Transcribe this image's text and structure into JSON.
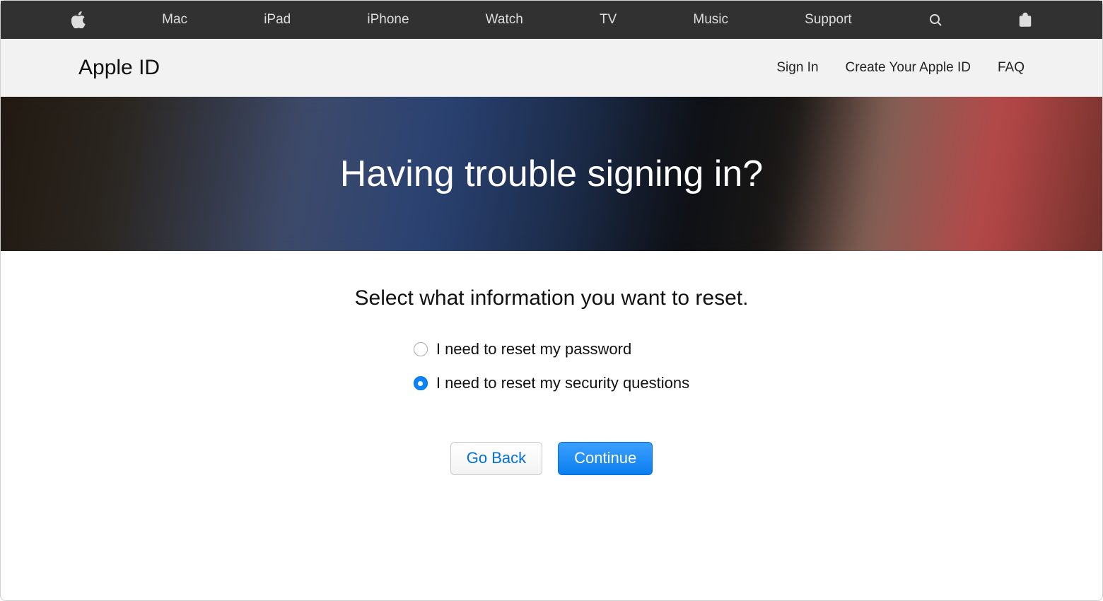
{
  "globalNav": {
    "items": [
      "Mac",
      "iPad",
      "iPhone",
      "Watch",
      "TV",
      "Music",
      "Support"
    ]
  },
  "subNav": {
    "title": "Apple ID",
    "links": [
      "Sign In",
      "Create Your Apple ID",
      "FAQ"
    ]
  },
  "hero": {
    "title": "Having trouble signing in?"
  },
  "main": {
    "prompt": "Select what information you want to reset.",
    "options": [
      {
        "label": "I need to reset my password",
        "selected": false
      },
      {
        "label": "I need to reset my security questions",
        "selected": true
      }
    ],
    "buttons": {
      "back": "Go Back",
      "continue": "Continue"
    }
  }
}
